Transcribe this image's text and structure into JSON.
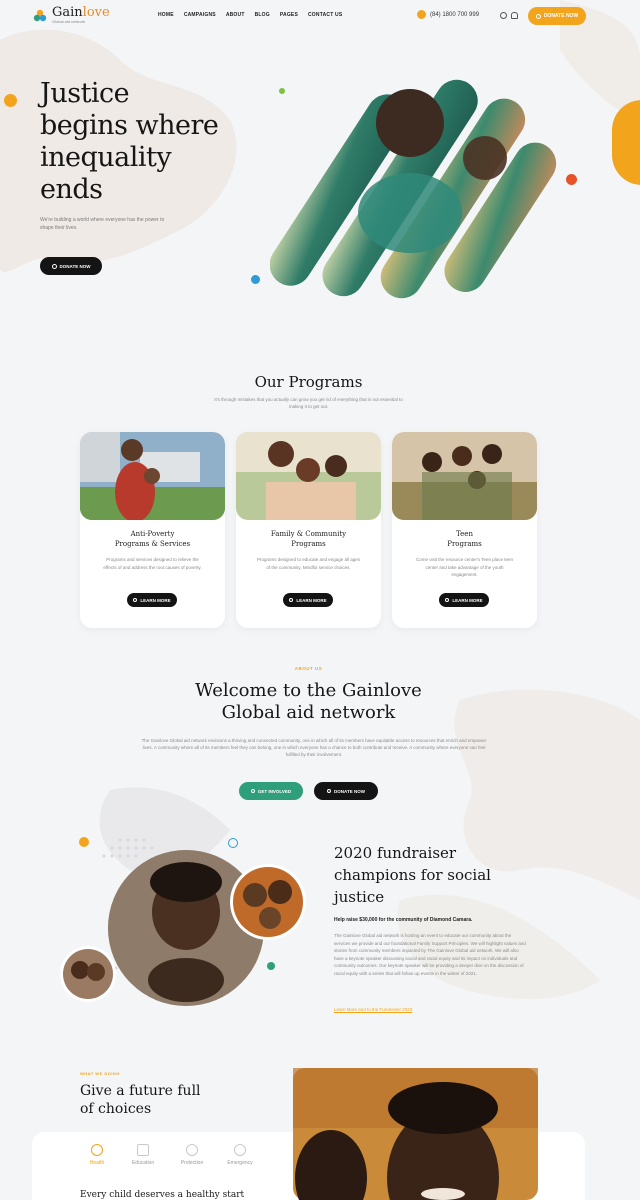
{
  "header": {
    "logo_name_part1": "Gain",
    "logo_name_part2": "love",
    "logo_tagline": "Global aid network",
    "nav": [
      "HOME",
      "CAMPAIGNS",
      "ABOUT",
      "BLOG",
      "PAGES",
      "CONTACT US"
    ],
    "phone": "(84) 1800 700 999",
    "donate_label": "DONATE NOW"
  },
  "hero": {
    "title_lines": [
      "Justice",
      "begins where",
      "inequality",
      "ends"
    ],
    "subtitle": "We're building a world where everyone has the power to shape their lives.",
    "button_label": "DONATE NOW"
  },
  "programs": {
    "title": "Our Programs",
    "subtitle": "It's through mistakes that you actually can grow you get rid of everything that is not essential to making it to get out.",
    "cards": [
      {
        "title_lines": [
          "Anti-Poverty",
          "Programs & Services"
        ],
        "text": "Programs and services designed to relieve the effects of and address the root causes of poverty.",
        "button_label": "LEARN MORE"
      },
      {
        "title_lines": [
          "Family & Community",
          "Programs"
        ],
        "text": "Programs designed to educate and engage all ages of the community. Mindful service choices.",
        "button_label": "LEARN MORE"
      },
      {
        "title_lines": [
          "Teen",
          "Programs"
        ],
        "text": "Come visit the resource center's Teen place teen center and take advantage of the youth engagement.",
        "button_label": "LEARN MORE"
      }
    ]
  },
  "about": {
    "eyebrow": "ABOUT US",
    "title_lines": [
      "Welcome to the Gainlove",
      "Global aid network"
    ],
    "text": "The Gainlove Global aid network envisions a thriving and connected community, one in which all of its members have equitable access to resources that enrich and empower lives. A community where all of its members feel they can belong, one in which everyone has a chance to both contribute and receive. A community where everyone can feel fulfilled by their involvement.",
    "primary_label": "GET INVOLVED",
    "secondary_label": "DONATE NOW"
  },
  "fundraiser": {
    "title_lines": [
      "2020 fundraiser",
      "champions for social",
      "justice"
    ],
    "lead": "Help raise $30,000 for the community of Diamond Camara.",
    "body": "The Gainlove Global aid network is hosting an event to educate our community about the services we provide and our foundational Family Support Principles. We will highlight values and stories from community members impacted by The Gainlove Global aid network. We will also have a keynote speaker discussing social and racial equity and its impact on individuals and community outcomes. Our keynote speaker will be providing a deeper dive on the discussion of racial equity with a series that will follow up events in the winter of 2021.",
    "link": "Learn More and to the Fundraiser 2020"
  },
  "future": {
    "eyebrow": "WHAT WE DOING",
    "title_lines": [
      "Give a future full",
      "of choices"
    ],
    "tabs": [
      "Health",
      "Education",
      "Protection",
      "Emergency"
    ],
    "active_tab": "Health",
    "panel_title": "Every child deserves a healthy start"
  },
  "colors": {
    "accent_orange": "#f2a41c",
    "teal": "#2f9e7a",
    "dark": "#141414",
    "dot_red": "#e8522a",
    "dot_blue": "#2e9bd6",
    "dot_green": "#7dc242"
  }
}
